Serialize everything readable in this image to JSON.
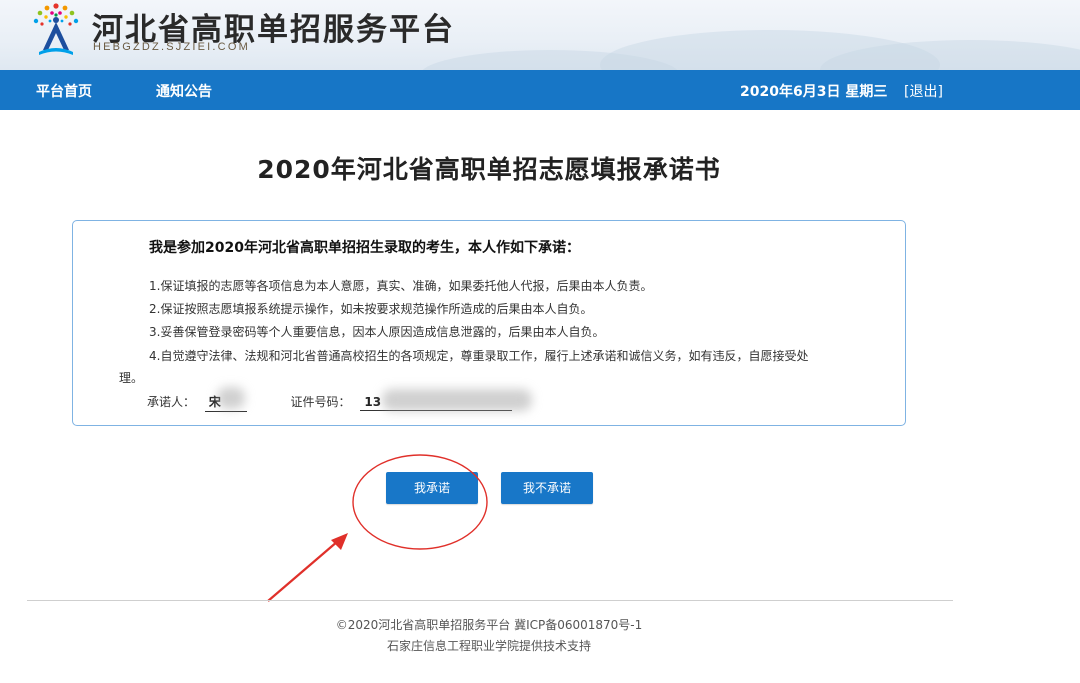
{
  "header": {
    "site_title": "河北省高职单招服务平台",
    "site_url": "HEBGZDZ.SJZIEI.COM"
  },
  "nav": {
    "links": [
      {
        "label": "平台首页"
      },
      {
        "label": "通知公告"
      }
    ],
    "date_text": "2020年6月3日 星期三",
    "logout_label": "[退出]"
  },
  "page": {
    "title": "2020年河北省高职单招志愿填报承诺书"
  },
  "pledge": {
    "heading": "我是参加2020年河北省高职单招招生录取的考生，本人作如下承诺：",
    "items": [
      "1.保证填报的志愿等各项信息为本人意愿，真实、准确，如果委托他人代报，后果由本人负责。",
      "2.保证按照志愿填报系统提示操作，如未按要求规范操作所造成的后果由本人自负。",
      "3.妥善保管登录密码等个人重要信息，因本人原因造成信息泄露的，后果由本人自负。",
      "4.自觉遵守法律、法规和河北省普通高校招生的各项规定，尊重录取工作，履行上述承诺和诚信义务，如有违反，自愿接受处"
    ],
    "item4_tail": "理。",
    "signer_label": "承诺人：",
    "signer_value": "宋",
    "id_label": "证件号码：",
    "id_value": "13"
  },
  "actions": {
    "agree_label": "我承诺",
    "disagree_label": "我不承诺"
  },
  "footer": {
    "copyright": "©2020河北省高职单招服务平台  冀ICP备06001870号-1",
    "support": "石家庄信息工程职业学院提供技术支持"
  },
  "colors": {
    "nav_bg": "#1776c6",
    "button_bg": "#1877c8",
    "box_border": "#7fb3e3",
    "annotation_red": "#e0302a"
  }
}
